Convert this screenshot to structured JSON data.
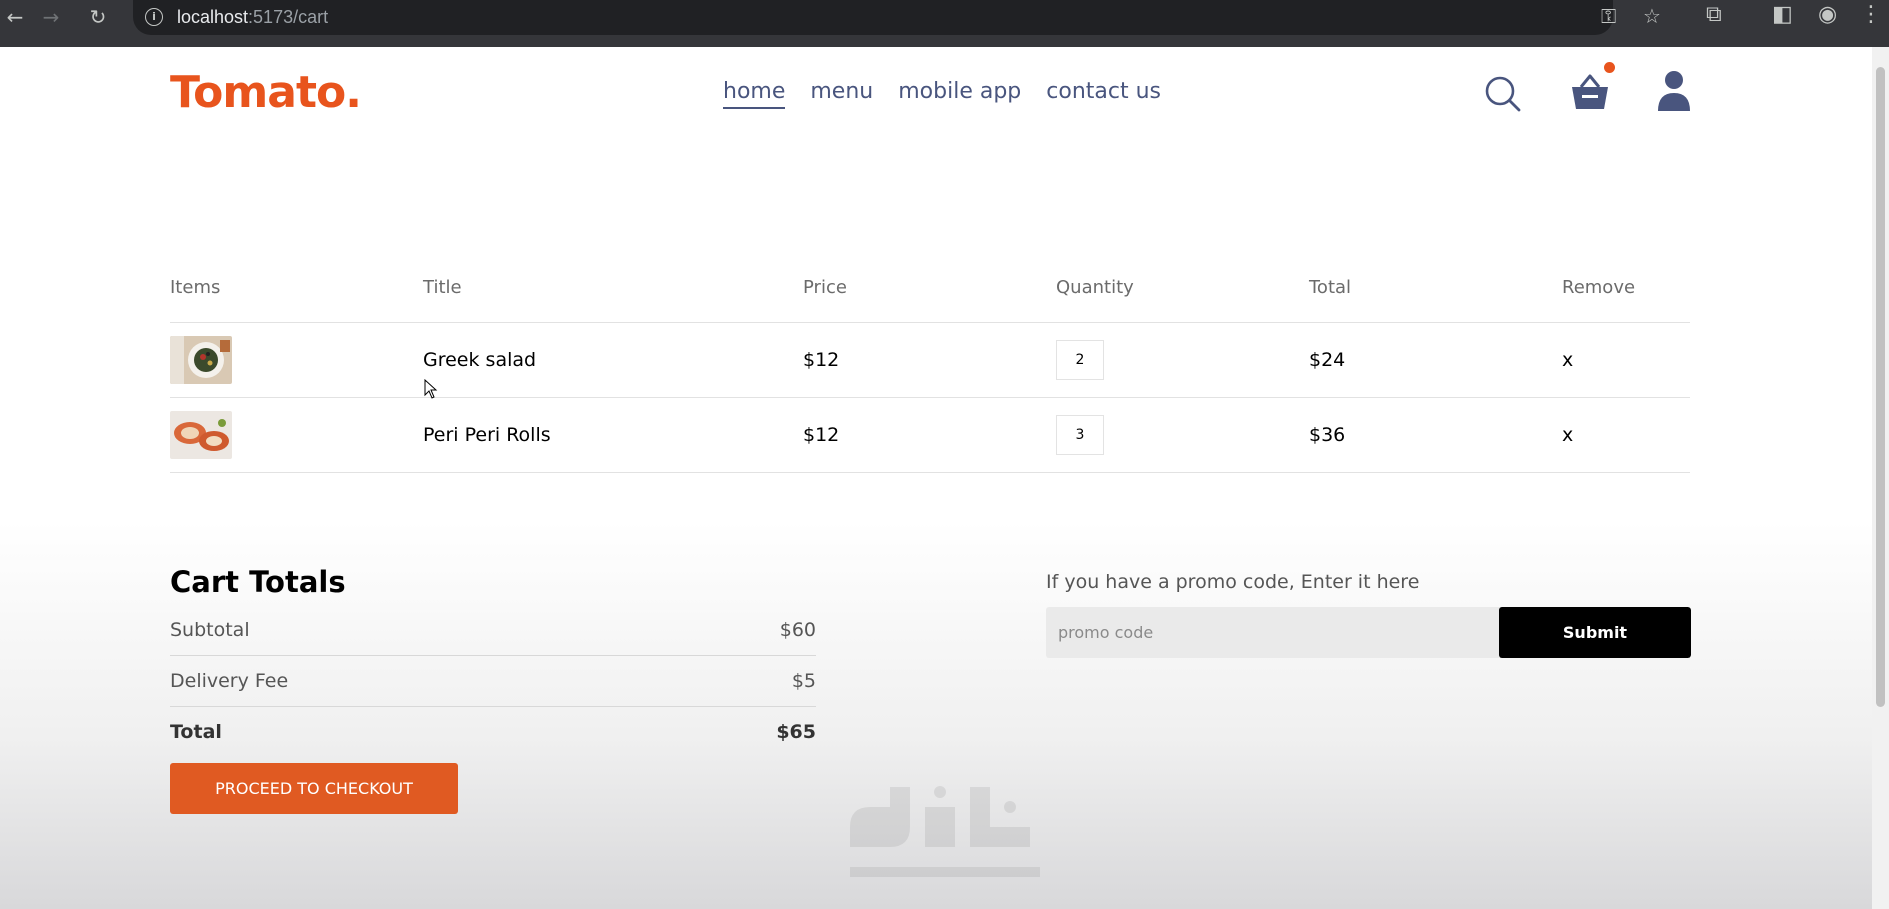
{
  "browser": {
    "url_host": "localhost",
    "url_path": ":5173/cart"
  },
  "navbar": {
    "logo": "Tomato.",
    "menu": [
      "home",
      "menu",
      "mobile app",
      "contact us"
    ],
    "active": "home",
    "icons": [
      "search-icon",
      "basket-icon",
      "profile-icon"
    ]
  },
  "cart": {
    "headers": [
      "Items",
      "Title",
      "Price",
      "Quantity",
      "Total",
      "Remove"
    ],
    "rows": [
      {
        "image": "greek-salad-image",
        "title": "Greek salad",
        "price": "$12",
        "quantity": "2",
        "total": "$24",
        "remove": "x"
      },
      {
        "image": "peri-peri-rolls-image",
        "title": "Peri Peri Rolls",
        "price": "$12",
        "quantity": "3",
        "total": "$36",
        "remove": "x"
      }
    ]
  },
  "totals": {
    "heading": "Cart Totals",
    "subtotal_label": "Subtotal",
    "subtotal_value": "$60",
    "delivery_label": "Delivery Fee",
    "delivery_value": "$5",
    "total_label": "Total",
    "total_value": "$65",
    "checkout_label": "PROCEED TO CHECKOUT"
  },
  "promo": {
    "label": "If you have a promo code, Enter it here",
    "placeholder": "promo code",
    "submit_label": "Submit"
  },
  "colors": {
    "brand": "#e8541d",
    "checkout": "#e05a22",
    "text": "#49557e"
  }
}
